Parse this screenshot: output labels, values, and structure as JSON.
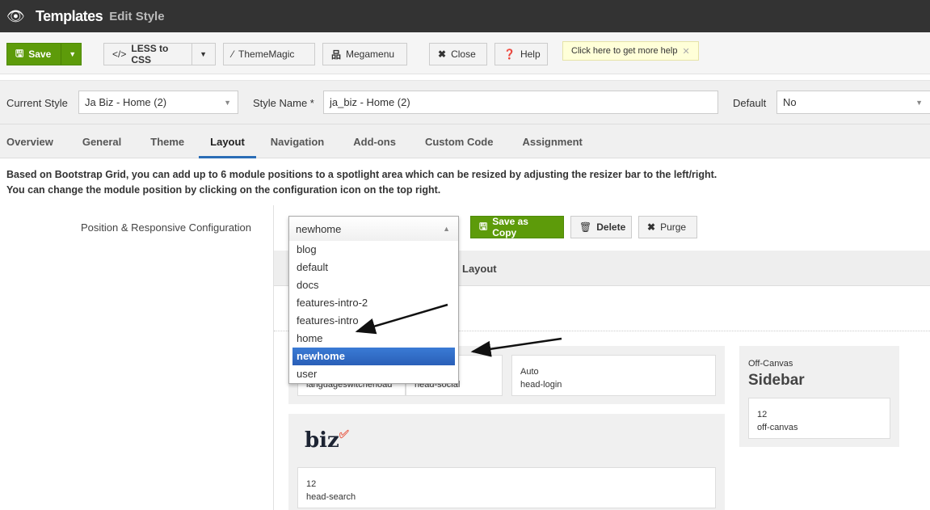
{
  "header": {
    "title": "Templates",
    "subtitle": "Edit Style",
    "icon": "eye-icon"
  },
  "toolbar": {
    "save": "Save",
    "less_to_css": "LESS to CSS",
    "thememagic": "ThemeMagic",
    "megamenu": "Megamenu",
    "close": "Close",
    "help": "Help",
    "tip": "Click here to get more help"
  },
  "style": {
    "current_style_label": "Current Style",
    "current_style_value": "Ja Biz - Home (2)",
    "style_name_label": "Style Name *",
    "style_name_value": "ja_biz - Home (2)",
    "default_label": "Default",
    "default_value": "No"
  },
  "tabs": [
    "Overview",
    "General",
    "Theme",
    "Layout",
    "Navigation",
    "Add-ons",
    "Custom Code",
    "Assignment"
  ],
  "active_tab": "Layout",
  "description": [
    "Based on Bootstrap Grid, you can add up to 6 module positions to a spotlight area which can be resized by adjusting the resizer bar to the left/right.",
    "You can change the module position by clicking on the configuration icon on the top right."
  ],
  "position": {
    "label": "Position & Responsive Configuration",
    "selected": "newhome",
    "options": [
      "blog",
      "default",
      "docs",
      "features-intro-2",
      "features-intro",
      "home",
      "newhome",
      "user"
    ],
    "save_as_copy": "Save as Copy",
    "delete": "Delete",
    "purge": "Purge"
  },
  "layout_bar": "Layout",
  "positions": {
    "header_row": [
      {
        "size": "",
        "name": "languageswitcherload"
      },
      {
        "size": "",
        "name": "head-social"
      },
      {
        "size": "Auto",
        "name": "head-login"
      }
    ],
    "logo": "biz",
    "search": {
      "size": "12",
      "name": "head-search"
    },
    "offcanvas": {
      "small": "Off-Canvas",
      "title": "Sidebar",
      "size": "12",
      "name": "off-canvas"
    }
  },
  "colors": {
    "green": "#5d9b0a",
    "highlight": "#2a6db6",
    "topbar": "#333333"
  }
}
